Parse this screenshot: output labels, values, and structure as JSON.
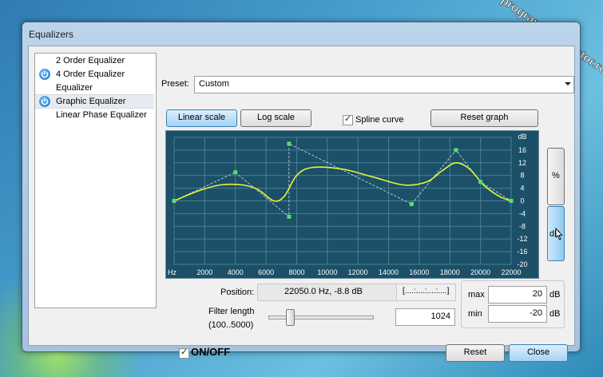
{
  "window": {
    "title": "Equalizers"
  },
  "equalizer_list": [
    {
      "label": "2 Order Equalizer",
      "power_icon": false,
      "selected": false
    },
    {
      "label": "4 Order Equalizer",
      "power_icon": true,
      "selected": false
    },
    {
      "label": "Equalizer",
      "power_icon": false,
      "selected": false
    },
    {
      "label": "Graphic Equalizer",
      "power_icon": true,
      "selected": true
    },
    {
      "label": "Linear Phase Equalizer",
      "power_icon": false,
      "selected": false
    }
  ],
  "preset": {
    "label": "Preset:",
    "value": "Custom"
  },
  "scale_buttons": {
    "linear": "Linear scale",
    "log": "Log scale"
  },
  "spline": {
    "label": "Spline curve",
    "checked": true
  },
  "reset_graph": "Reset graph",
  "graph": {
    "y_unit": "dB",
    "x_unit": "Hz",
    "x_ticks": [
      "2000",
      "4000",
      "6000",
      "8000",
      "10000",
      "12000",
      "14000",
      "16000",
      "18000",
      "20000",
      "22000"
    ],
    "y_ticks": [
      "16",
      "12",
      "8",
      "4",
      "0",
      "-4",
      "-8",
      "-12",
      "-16",
      "-20"
    ],
    "control_points": [
      {
        "hz": 0,
        "db": 0
      },
      {
        "hz": 4000,
        "db": 9
      },
      {
        "hz": 7500,
        "db": -5
      },
      {
        "hz": 7500,
        "db": 18
      },
      {
        "hz": 15500,
        "db": -1
      },
      {
        "hz": 18400,
        "db": 16
      },
      {
        "hz": 20000,
        "db": 6
      },
      {
        "hz": 22000,
        "db": 0
      }
    ],
    "colors": {
      "background": "#1b5068",
      "grid": "#4a7f94",
      "curve": "#e8f53a",
      "points": "#5adf6a"
    }
  },
  "side_buttons": {
    "percent": "%",
    "db": "dB"
  },
  "position": {
    "label": "Position:",
    "value": "22050.0 Hz, -8.8 dB",
    "indicator": "[....:....:....:....]"
  },
  "limits": {
    "max_label": "max",
    "max_value": "20",
    "min_label": "min",
    "min_value": "-20",
    "unit": "dB"
  },
  "filter": {
    "label": "Filter length",
    "range": "(100..5000)",
    "value": "1024"
  },
  "onoff": {
    "label": "ON/OFF",
    "checked": true
  },
  "buttons": {
    "reset": "Reset",
    "close": "Close"
  },
  "watermark": "programecalculator.ro"
}
